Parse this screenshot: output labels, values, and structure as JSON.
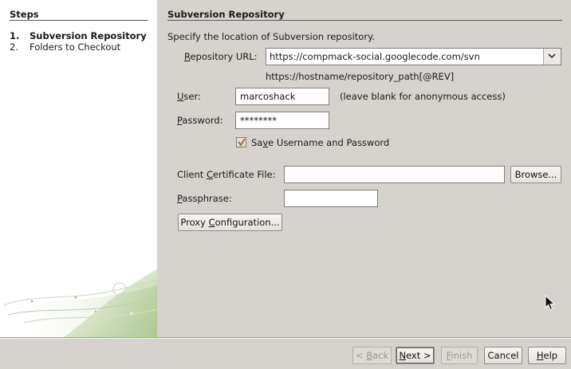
{
  "steps": {
    "title": "Steps",
    "items": [
      {
        "num": "1.",
        "label": "Subversion Repository"
      },
      {
        "num": "2.",
        "label": "Folders to Checkout"
      }
    ]
  },
  "content": {
    "title": "Subversion Repository",
    "description": "Specify the location of Subversion repository.",
    "repository_url_label": "Repository URL:",
    "repository_url_value": "https://compmack-social.googlecode.com/svn",
    "repository_url_hint": "https://hostname/repository_path[@REV]",
    "user_label": "User:",
    "user_value": "marcoshack",
    "user_hint": "(leave blank for anonymous access)",
    "password_label": "Password:",
    "password_value": "********",
    "save_label": "Save Username and Password",
    "save_checked": true,
    "cert_label": "Client Certificate File:",
    "cert_value": "",
    "browse_label": "Browse...",
    "passphrase_label": "Passphrase:",
    "passphrase_value": "",
    "proxy_label": "Proxy Configuration..."
  },
  "buttons": {
    "back": "< Back",
    "next": "Next >",
    "finish": "Finish",
    "cancel": "Cancel",
    "help": "Help"
  },
  "colors": {
    "dialog_bg": "#d6d3ce",
    "panel_bg": "#ffffff"
  }
}
